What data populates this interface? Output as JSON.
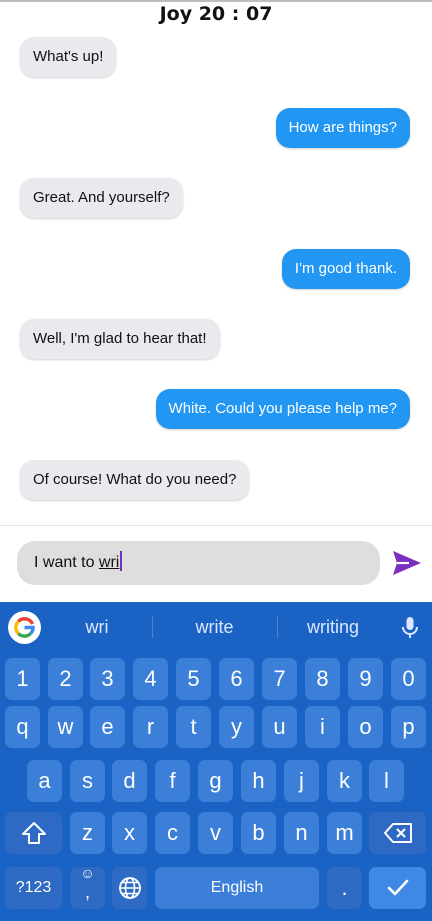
{
  "header": {
    "title": "Joy 20 : 07"
  },
  "messages": [
    {
      "side": "in",
      "text": "What's up!"
    },
    {
      "side": "out",
      "text": "How are things?"
    },
    {
      "side": "in",
      "text": "Great. And yourself?"
    },
    {
      "side": "out",
      "text": "I'm good thank."
    },
    {
      "side": "in",
      "text": "Well, I'm glad to hear that!"
    },
    {
      "side": "out",
      "text": "White. Could you please help me?"
    },
    {
      "side": "in",
      "text": "Of course!  What do you need?"
    }
  ],
  "composer": {
    "prefix": "I want to ",
    "composing": "wri"
  },
  "keyboard": {
    "suggestions": [
      "wri",
      "write",
      "writing"
    ],
    "number_row": [
      "1",
      "2",
      "3",
      "4",
      "5",
      "6",
      "7",
      "8",
      "9",
      "0"
    ],
    "row1": [
      "q",
      "w",
      "e",
      "r",
      "t",
      "y",
      "u",
      "i",
      "o",
      "p"
    ],
    "row2": [
      "a",
      "s",
      "d",
      "f",
      "g",
      "h",
      "j",
      "k",
      "l"
    ],
    "row3": [
      "z",
      "x",
      "c",
      "v",
      "b",
      "n",
      "m"
    ],
    "symbols_label": "?123",
    "emoji_glyph": "☺",
    "comma_label": ",",
    "space_label": "English",
    "period_label": "."
  },
  "colors": {
    "outgoing": "#2196f3",
    "incoming": "#e9e9ee",
    "keyboard": "#1a63c4",
    "send": "#7b2fbe"
  }
}
